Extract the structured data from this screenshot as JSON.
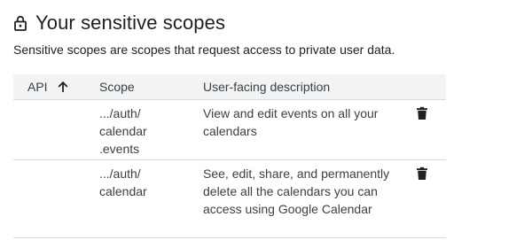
{
  "header": {
    "title": "Your sensitive scopes",
    "lock_icon": "lock-icon",
    "subtitle": "Sensitive scopes are scopes that request access to private user data."
  },
  "table": {
    "columns": {
      "api": "API",
      "scope": "Scope",
      "description": "User-facing description"
    },
    "sort_icon": "arrow-up-icon",
    "rows": [
      {
        "api": "",
        "scope": ".../auth/\ncalendar\n.events",
        "description": "View and edit events on all your calendars",
        "action_icon": "trash-icon"
      },
      {
        "api": "",
        "scope": ".../auth/\ncalendar",
        "description": "See, edit, share, and permanently delete all the calendars you can access using Google Calendar",
        "action_icon": "trash-icon"
      }
    ]
  },
  "colors": {
    "text_primary": "#202124",
    "text_secondary": "#3c4043",
    "header_bg": "#f1f3f4",
    "divider": "#dadce0"
  }
}
